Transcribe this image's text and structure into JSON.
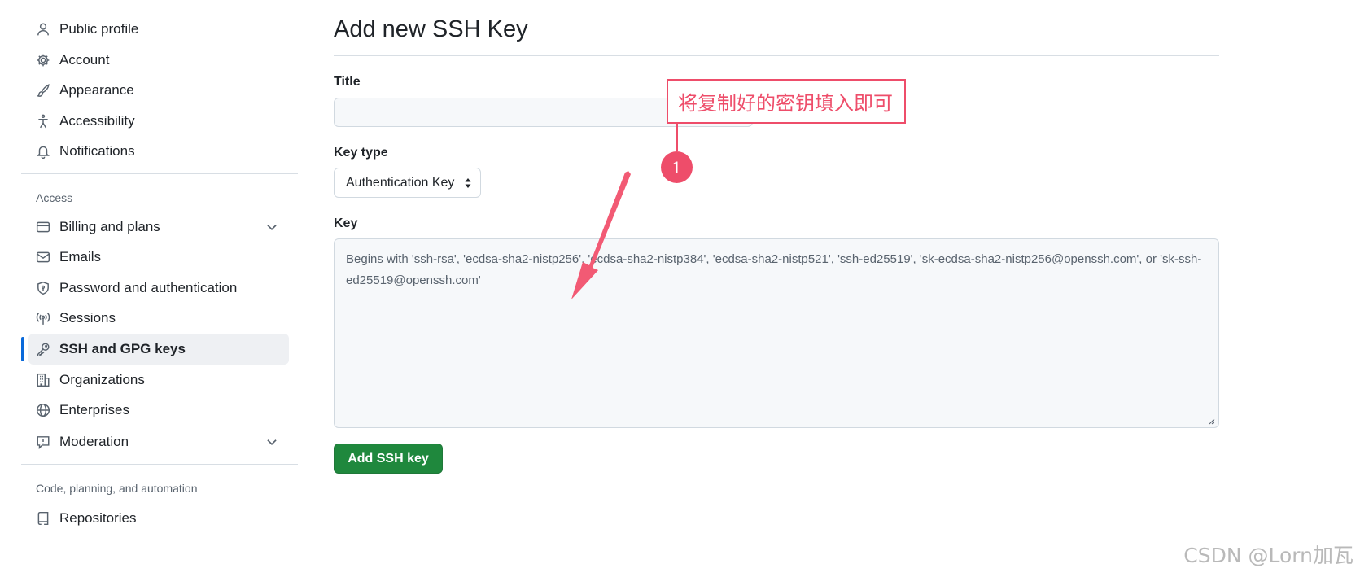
{
  "sidebar": {
    "top_items": [
      {
        "label": "Public profile",
        "icon": "person-icon"
      },
      {
        "label": "Account",
        "icon": "gear-icon"
      },
      {
        "label": "Appearance",
        "icon": "paintbrush-icon"
      },
      {
        "label": "Accessibility",
        "icon": "accessibility-icon"
      },
      {
        "label": "Notifications",
        "icon": "bell-icon"
      }
    ],
    "access_title": "Access",
    "access_items": [
      {
        "label": "Billing and plans",
        "icon": "credit-card-icon",
        "expandable": true
      },
      {
        "label": "Emails",
        "icon": "mail-icon"
      },
      {
        "label": "Password and authentication",
        "icon": "shield-lock-icon"
      },
      {
        "label": "Sessions",
        "icon": "broadcast-icon"
      },
      {
        "label": "SSH and GPG keys",
        "icon": "key-icon",
        "active": true
      },
      {
        "label": "Organizations",
        "icon": "organization-icon"
      },
      {
        "label": "Enterprises",
        "icon": "globe-icon"
      },
      {
        "label": "Moderation",
        "icon": "report-icon",
        "expandable": true
      }
    ],
    "code_title": "Code, planning, and automation",
    "code_items": [
      {
        "label": "Repositories",
        "icon": "repo-icon"
      }
    ]
  },
  "main": {
    "page_title": "Add new SSH Key",
    "title_label": "Title",
    "title_value": "",
    "key_type_label": "Key type",
    "key_type_selected": "Authentication Key",
    "key_label": "Key",
    "key_placeholder": "Begins with 'ssh-rsa', 'ecdsa-sha2-nistp256', 'ecdsa-sha2-nistp384', 'ecdsa-sha2-nistp521', 'ssh-ed25519', 'sk-ecdsa-sha2-nistp256@openssh.com', or 'sk-ssh-ed25519@openssh.com'",
    "submit_label": "Add SSH key"
  },
  "annotation": {
    "callout_text": "将复制好的密钥填入即可",
    "marker_number": "1",
    "color": "#ee4d6a"
  },
  "watermark": "CSDN @Lorn加瓦",
  "colors": {
    "accent": "#0969da",
    "primary_button": "#1f883d",
    "active_item_bg": "#eef0f3"
  }
}
